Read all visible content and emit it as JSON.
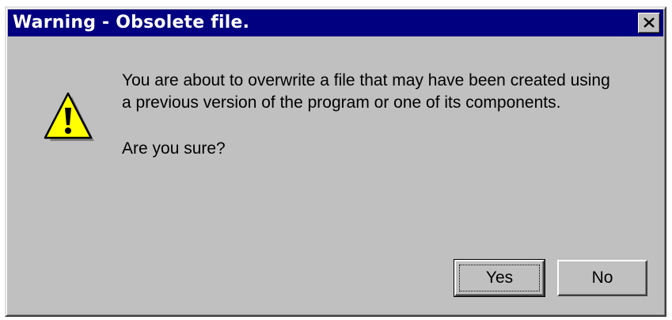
{
  "window": {
    "title": "Warning - Obsolete file.",
    "close_icon": "close-icon"
  },
  "dialog": {
    "icon": "warning-icon",
    "message_lines": [
      "You are about to overwrite a file that may have been created using",
      "a previous version of the program or one of its components."
    ],
    "question": "Are you sure?"
  },
  "buttons": {
    "yes_label": "Yes",
    "no_label": "No",
    "default_button": "Yes"
  },
  "colors": {
    "titlebar": "#000080",
    "face": "#c0c0c0",
    "warning_yellow": "#ffff00"
  }
}
